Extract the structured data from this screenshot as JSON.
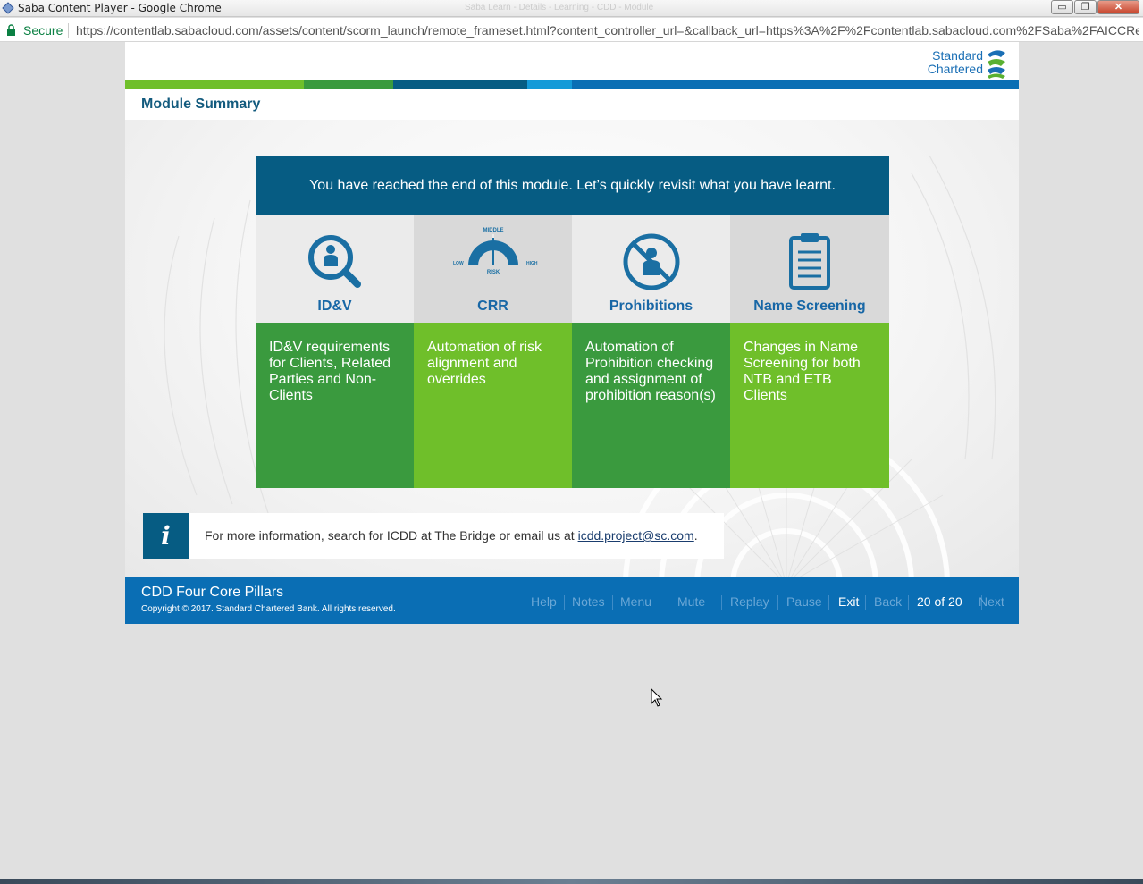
{
  "window": {
    "title": "Saba Content Player - Google Chrome",
    "ghost_title": "Saba Learn - Details - Learning - CDD - Module",
    "controls": {
      "minimize": "▭",
      "maximize": "❐",
      "close": "✕"
    }
  },
  "address_bar": {
    "secure_label": "Secure",
    "url": "https://contentlab.sabacloud.com/assets/content/scorm_launch/remote_frameset.html?content_controller_url=&callback_url=https%3A%2F%2Fcontentlab.sabacloud.com%2FSaba%2FAICCRepo"
  },
  "brand": {
    "logo_line1": "Standard",
    "logo_line2": "Chartered",
    "colors": {
      "dark_blue": "#065c83",
      "blue": "#0a6eb4",
      "green": "#3a9a3e",
      "light_green": "#6fbf2a"
    },
    "stripe_colors": [
      "#6fbf2a",
      "#3a9a3e",
      "#065c83",
      "#149ad8",
      "#0a6eb4"
    ]
  },
  "page": {
    "heading": "Module Summary",
    "banner": "You have reached the end of this module. Let’s quickly revisit what you have learnt.",
    "pillars": [
      {
        "title": "ID&V",
        "icon": "magnifier-person-icon",
        "text": "ID&V requirements for Clients, Related Parties and Non-Clients"
      },
      {
        "title": "CRR",
        "icon": "risk-gauge-icon",
        "gauge_labels": {
          "low": "LOW",
          "middle": "MIDDLE",
          "high": "HIGH",
          "risk": "RISK"
        },
        "text": "Automation of risk alignment and overrides"
      },
      {
        "title": "Prohibitions",
        "icon": "prohibited-person-icon",
        "text": "Automation of Prohibition checking and assignment of prohibition reason(s)"
      },
      {
        "title": "Name Screening",
        "icon": "clipboard-icon",
        "text": "Changes in Name Screening for both NTB and ETB Clients"
      }
    ],
    "info": {
      "icon_glyph": "i",
      "text": "For more information, search for ICDD at The Bridge or email us at ",
      "email": "icdd.project@sc.com",
      "suffix": "."
    }
  },
  "footer": {
    "course_title": "CDD Four Core Pillars",
    "copyright": "Copyright © 2017. Standard Chartered Bank. All rights reserved.",
    "nav": {
      "help": "Help",
      "notes": "Notes",
      "menu": "Menu",
      "mute": "Mute",
      "replay": "Replay",
      "pause": "Pause",
      "exit": "Exit",
      "back": "Back",
      "page_counter": "20 of 20",
      "next": "Next"
    }
  }
}
